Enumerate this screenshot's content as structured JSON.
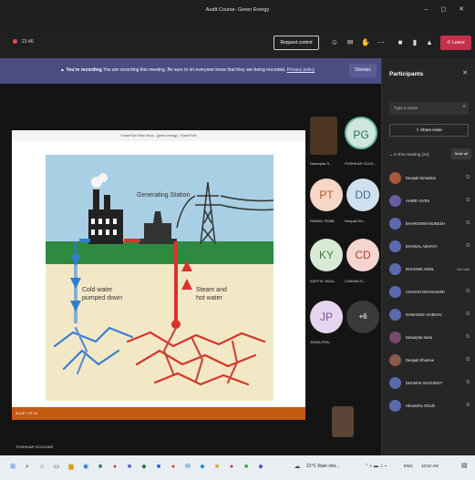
{
  "window": {
    "title": "Audit Course- Green Energy",
    "controls": "– ◻ ✕"
  },
  "toolbar": {
    "timer": "21:46",
    "request_control": "Request control",
    "leave": "Leave"
  },
  "recording": {
    "label": "You're recording",
    "message": "You are recording this meeting. Be sure to let everyone know that they are being recorded.",
    "policy_link": "Privacy policy",
    "dismiss": "Dismiss"
  },
  "presentation": {
    "window_title": "PowerPoint Slide Show - [green energy] - PowerPoint",
    "status": "SLIDE 7 OF 16",
    "presenter": "PUSHKAR GOLEGAR"
  },
  "slide": {
    "station_label": "Generating Station",
    "cold_label_1": "Cold water",
    "cold_label_2": "pumped down",
    "hot_label_1": "Steam and",
    "hot_label_2": "hot water",
    "colors": {
      "sky": "#a8cfe4",
      "ground": "#2e8a3f",
      "soil": "#f3e8c6",
      "cold": "#2f7fcf",
      "hot": "#d8342c"
    }
  },
  "tiles": [
    {
      "initials": "",
      "name": "Debarpita S...",
      "color": "#5a3a2a"
    },
    {
      "initials": "PG",
      "name": "PUSHKAR GOLE...",
      "color": "#cfe6dc"
    },
    {
      "initials": "PT",
      "name": "PAWAN TEMB...",
      "color": "#f6d6c6"
    },
    {
      "initials": "DD",
      "name": "Deepali Dh...",
      "color": "#cfe0ee"
    },
    {
      "initials": "KY",
      "name": "KARTIK YADA...",
      "color": "#d8ead6"
    },
    {
      "initials": "CD",
      "name": "CHAVAN D...",
      "color": "#f4d5cf"
    },
    {
      "initials": "JP",
      "name": "JIGNA PRA...",
      "color": "#e4d6ee"
    },
    {
      "initials": "+6",
      "name": "",
      "color": "#3a3a3a"
    }
  ],
  "participants": {
    "title": "Participants",
    "search_placeholder": "Type a name",
    "share_invite": "Share invite",
    "in_meeting": "In this meeting (24)",
    "mute_all": "Mute all",
    "list": [
      {
        "name": "Deepali Nimsokar",
        "badge": ""
      },
      {
        "name": "AHIRE VIVEK",
        "badge": ""
      },
      {
        "name": "BHARGWWI MUKESH",
        "badge": ""
      },
      {
        "name": "BHAWAL ABHAYA",
        "badge": ""
      },
      {
        "name": "BHAGWE AMOL",
        "badge": "On hold"
      },
      {
        "name": "CHAVAN DHANASHRI",
        "badge": ""
      },
      {
        "name": "DAWANDE VAIBHAV",
        "badge": ""
      },
      {
        "name": "Debarpita Saha",
        "badge": ""
      },
      {
        "name": "Deepali Dhumne",
        "badge": ""
      },
      {
        "name": "DHAMAK NACHIKET",
        "badge": ""
      },
      {
        "name": "Himanshu Shodri",
        "badge": ""
      }
    ]
  },
  "taskbar": {
    "weather": "21°C Rain sho...",
    "lang": "ENG",
    "time": "10:52 AM"
  }
}
